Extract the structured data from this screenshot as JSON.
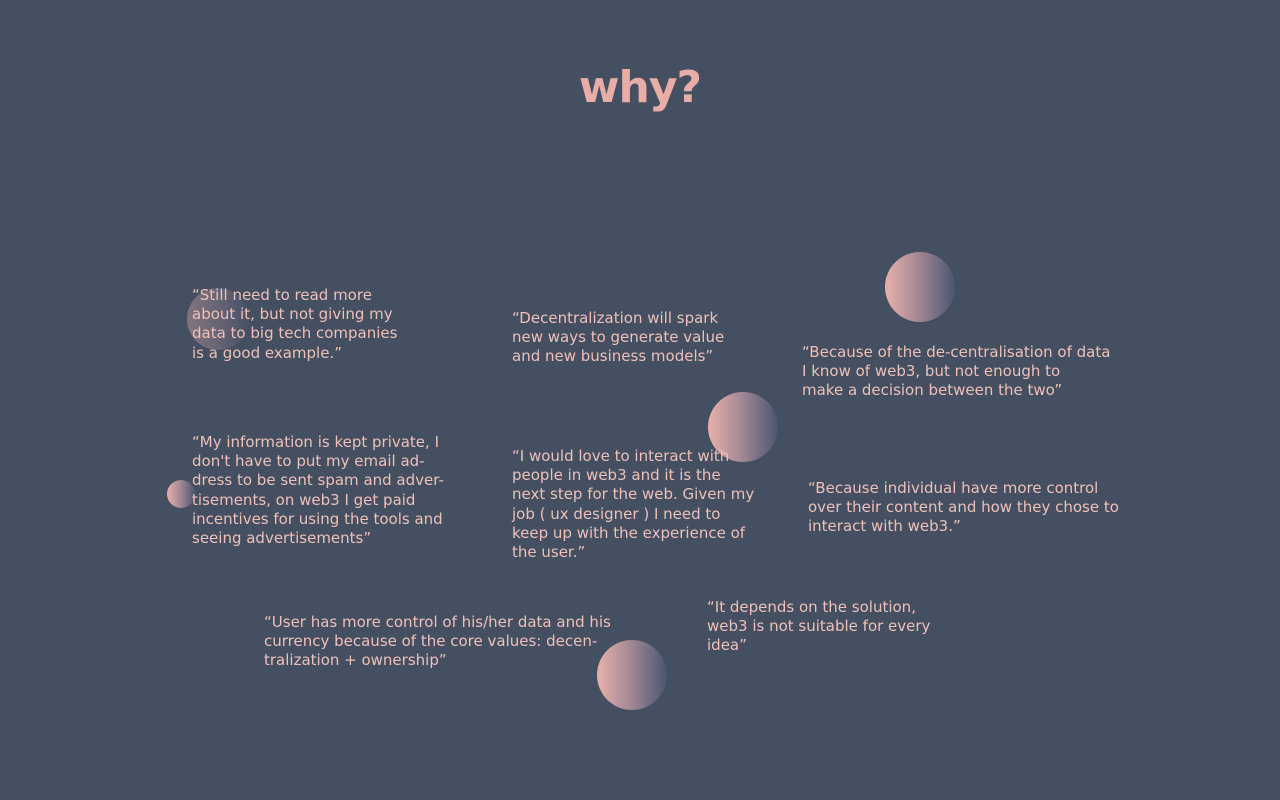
{
  "slide": {
    "title": "why?",
    "colors": {
      "background": "#444f61",
      "accent": "#e8ada6",
      "text": "#efc0b8",
      "orb_light": "#e8b1aa",
      "orb_dark": "#4a5670"
    },
    "quotes": [
      {
        "id": "q1",
        "text": "“Still need to read more\nabout it, but not giving my\ndata to big tech companies\nis a good example.”"
      },
      {
        "id": "q2",
        "text": "“Decentralization will spark\nnew ways to generate value\nand new business models”"
      },
      {
        "id": "q3",
        "text": "“Because of the de-centralisation of data\nI know of web3, but not enough to\nmake a decision between the two”"
      },
      {
        "id": "q4",
        "text": "“My information is kept private, I\ndon't have to put my email ad-\ndress to be sent spam and adver-\ntisements, on web3 I get paid\nincentives for using the tools and\nseeing advertisements”"
      },
      {
        "id": "q5",
        "text": "“I would love to interact with\npeople in web3 and it is the\nnext step for the web. Given my\njob ( ux designer ) I need to\nkeep up with the experience of\nthe user.”"
      },
      {
        "id": "q6",
        "text": "“Because individual have more control\nover their content and how they chose to\ninteract with web3.”"
      },
      {
        "id": "q7",
        "text": "“User has more control of his/her data and his\ncurrency because of the core values: decen-\ntralization + ownership”"
      },
      {
        "id": "q8",
        "text": "“It depends on the solution,\nweb3 is not suitable for every\nidea”"
      }
    ]
  }
}
